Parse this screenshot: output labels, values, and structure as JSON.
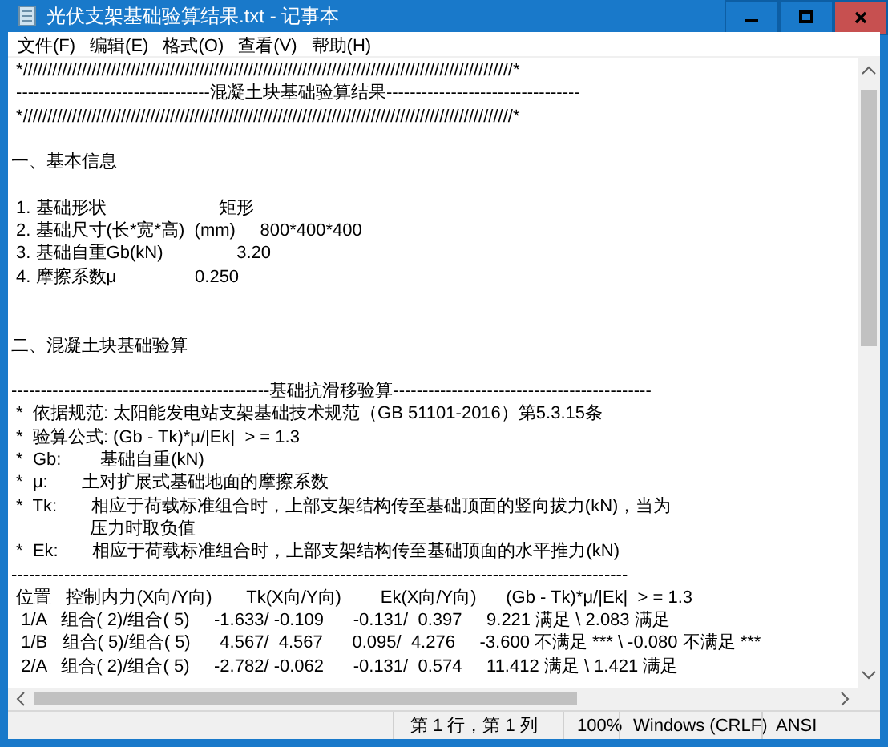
{
  "window": {
    "title": "光伏支架基础验算结果.txt - 记事本"
  },
  "menu": [
    "文件(F)",
    "编辑(E)",
    "格式(O)",
    "查看(V)",
    "帮助(H)"
  ],
  "banner": [
    " *////////////////////////////////////////////////////////////////////////////////////////////////////*",
    " ---------------------------------混凝土块基础验算结果---------------------------------",
    " *////////////////////////////////////////////////////////////////////////////////////////////////////*"
  ],
  "sections": [
    {
      "heading": "一、基本信息",
      "lines": [
        " 1. 基础形状                       矩形",
        " 2. 基础尺寸(长*宽*高)  (mm)     800*400*400",
        " 3. 基础自重Gb(kN)               3.20",
        " 4. 摩擦系数μ                0.250"
      ]
    },
    {
      "heading": "二、混凝土块基础验算",
      "lines": [
        "--------------------------------------------基础抗滑移验算--------------------------------------------",
        " *  依据规范: 太阳能发电站支架基础技术规范（GB 51101-2016）第5.3.15条",
        " *  验算公式: (Gb - Tk)*μ/|Ek|  > = 1.3",
        " *  Gb:        基础自重(kN)",
        " *  μ:       土对扩展式基础地面的摩擦系数",
        " *  Tk:       相应于荷载标准组合时，上部支架结构传至基础顶面的竖向拔力(kN)，当为",
        "                压力时取负值",
        " *  Ek:       相应于荷载标准组合时，上部支架结构传至基础顶面的水平推力(kN)",
        "---------------------------------------------------------------------------------------------------------",
        " 位置   控制内力(X向/Y向)       Tk(X向/Y向)        Ek(X向/Y向)      (Gb - Tk)*μ/|Ek|  > = 1.3",
        "  1/A   组合( 2)/组合( 5)     -1.633/ -0.109      -0.131/  0.397     9.221 满足 \\ 2.083 满足",
        "  1/B   组合( 5)/组合( 5)      4.567/  4.567      0.095/  4.276     -3.600 不满足 *** \\ -0.080 不满足 ***",
        "  2/A   组合( 2)/组合( 5)     -2.782/ -0.062      -0.131/  0.574     11.412 满足 \\ 1.421 满足"
      ]
    }
  ],
  "status_bar": [
    "第 1 行，第 1 列",
    "100%",
    "Windows (CRLF)",
    "ANSI"
  ]
}
